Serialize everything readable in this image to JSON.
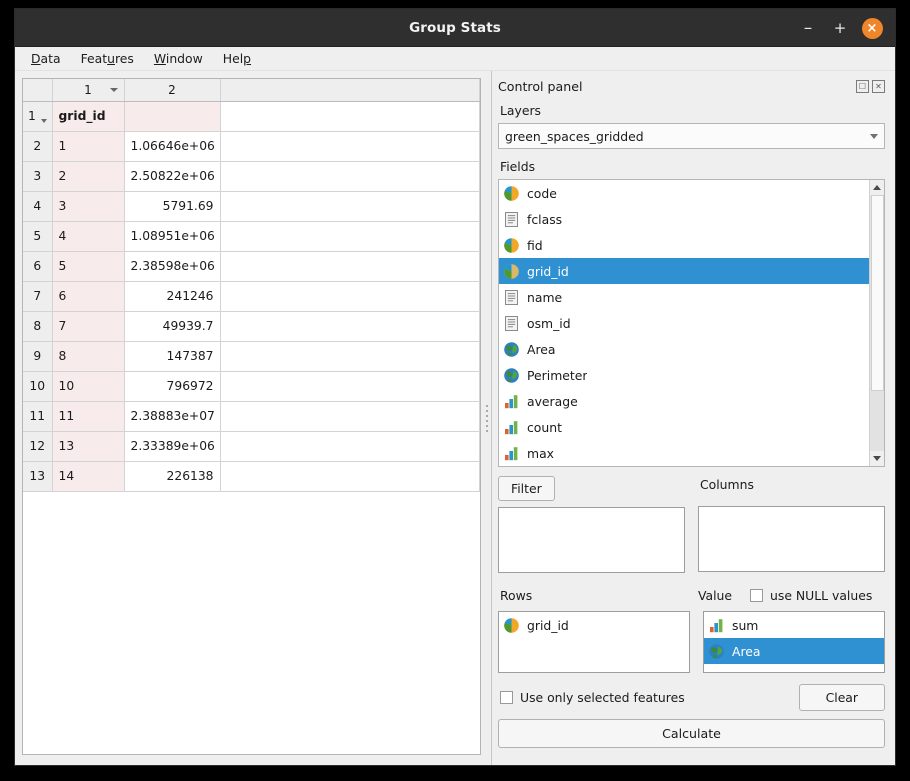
{
  "window": {
    "title": "Group Stats",
    "buttons": {
      "minimize": "–",
      "maximize": "+",
      "close": "×"
    }
  },
  "menubar": [
    {
      "label": "Data",
      "mnemonic": "D"
    },
    {
      "label": "Features",
      "mnemonic": "u"
    },
    {
      "label": "Window",
      "mnemonic": "W"
    },
    {
      "label": "Help",
      "mnemonic": "p"
    }
  ],
  "table": {
    "column_headers": [
      "1",
      "2"
    ],
    "rows": [
      {
        "header": "1",
        "c1": "grid_id",
        "c2": "",
        "is_header_row": true
      },
      {
        "header": "2",
        "c1": "1",
        "c2": "1.06646e+06"
      },
      {
        "header": "3",
        "c1": "2",
        "c2": "2.50822e+06"
      },
      {
        "header": "4",
        "c1": "3",
        "c2": "5791.69"
      },
      {
        "header": "5",
        "c1": "4",
        "c2": "1.08951e+06"
      },
      {
        "header": "6",
        "c1": "5",
        "c2": "2.38598e+06"
      },
      {
        "header": "7",
        "c1": "6",
        "c2": "241246"
      },
      {
        "header": "8",
        "c1": "7",
        "c2": "49939.7"
      },
      {
        "header": "9",
        "c1": "8",
        "c2": "147387"
      },
      {
        "header": "10",
        "c1": "10",
        "c2": "796972"
      },
      {
        "header": "11",
        "c1": "11",
        "c2": "2.38883e+07"
      },
      {
        "header": "12",
        "c1": "13",
        "c2": "2.33389e+06"
      },
      {
        "header": "13",
        "c1": "14",
        "c2": "226138"
      }
    ]
  },
  "control_panel": {
    "title": "Control panel",
    "dock_icons": {
      "float": "float-icon",
      "close": "close-icon"
    },
    "layers": {
      "label": "Layers",
      "selected": "green_spaces_gridded"
    },
    "fields": {
      "label": "Fields",
      "items": [
        {
          "name": "code",
          "icon": "integer-field-icon",
          "selected": false
        },
        {
          "name": "fclass",
          "icon": "text-field-icon",
          "selected": false
        },
        {
          "name": "fid",
          "icon": "integer-field-icon",
          "selected": false
        },
        {
          "name": "grid_id",
          "icon": "integer-field-icon",
          "selected": true
        },
        {
          "name": "name",
          "icon": "text-field-icon",
          "selected": false
        },
        {
          "name": "osm_id",
          "icon": "text-field-icon",
          "selected": false
        },
        {
          "name": "Area",
          "icon": "geometry-icon",
          "selected": false
        },
        {
          "name": "Perimeter",
          "icon": "geometry-icon",
          "selected": false
        },
        {
          "name": "average",
          "icon": "aggregate-icon",
          "selected": false
        },
        {
          "name": "count",
          "icon": "aggregate-icon",
          "selected": false
        },
        {
          "name": "max",
          "icon": "aggregate-icon",
          "selected": false
        }
      ]
    },
    "filter": {
      "button_label": "Filter",
      "value": ""
    },
    "columns": {
      "label": "Columns",
      "items": []
    },
    "rows": {
      "label": "Rows",
      "items": [
        {
          "name": "grid_id",
          "icon": "integer-field-icon",
          "selected": false
        }
      ]
    },
    "value": {
      "label": "Value",
      "items": [
        {
          "name": "sum",
          "icon": "aggregate-icon",
          "selected": false
        },
        {
          "name": "Area",
          "icon": "geometry-icon",
          "selected": true
        }
      ]
    },
    "use_null_values": {
      "label": "use NULL values",
      "checked": false
    },
    "use_only_selected": {
      "label": "Use only selected features",
      "checked": false
    },
    "clear_button": "Clear",
    "calculate_button": "Calculate"
  },
  "colors": {
    "selection_blue": "#3091d2",
    "titlebar": "#302f2f",
    "close_orange": "#f0862a",
    "table_pink": "#f7eceb",
    "panel_bg": "#efefef"
  }
}
